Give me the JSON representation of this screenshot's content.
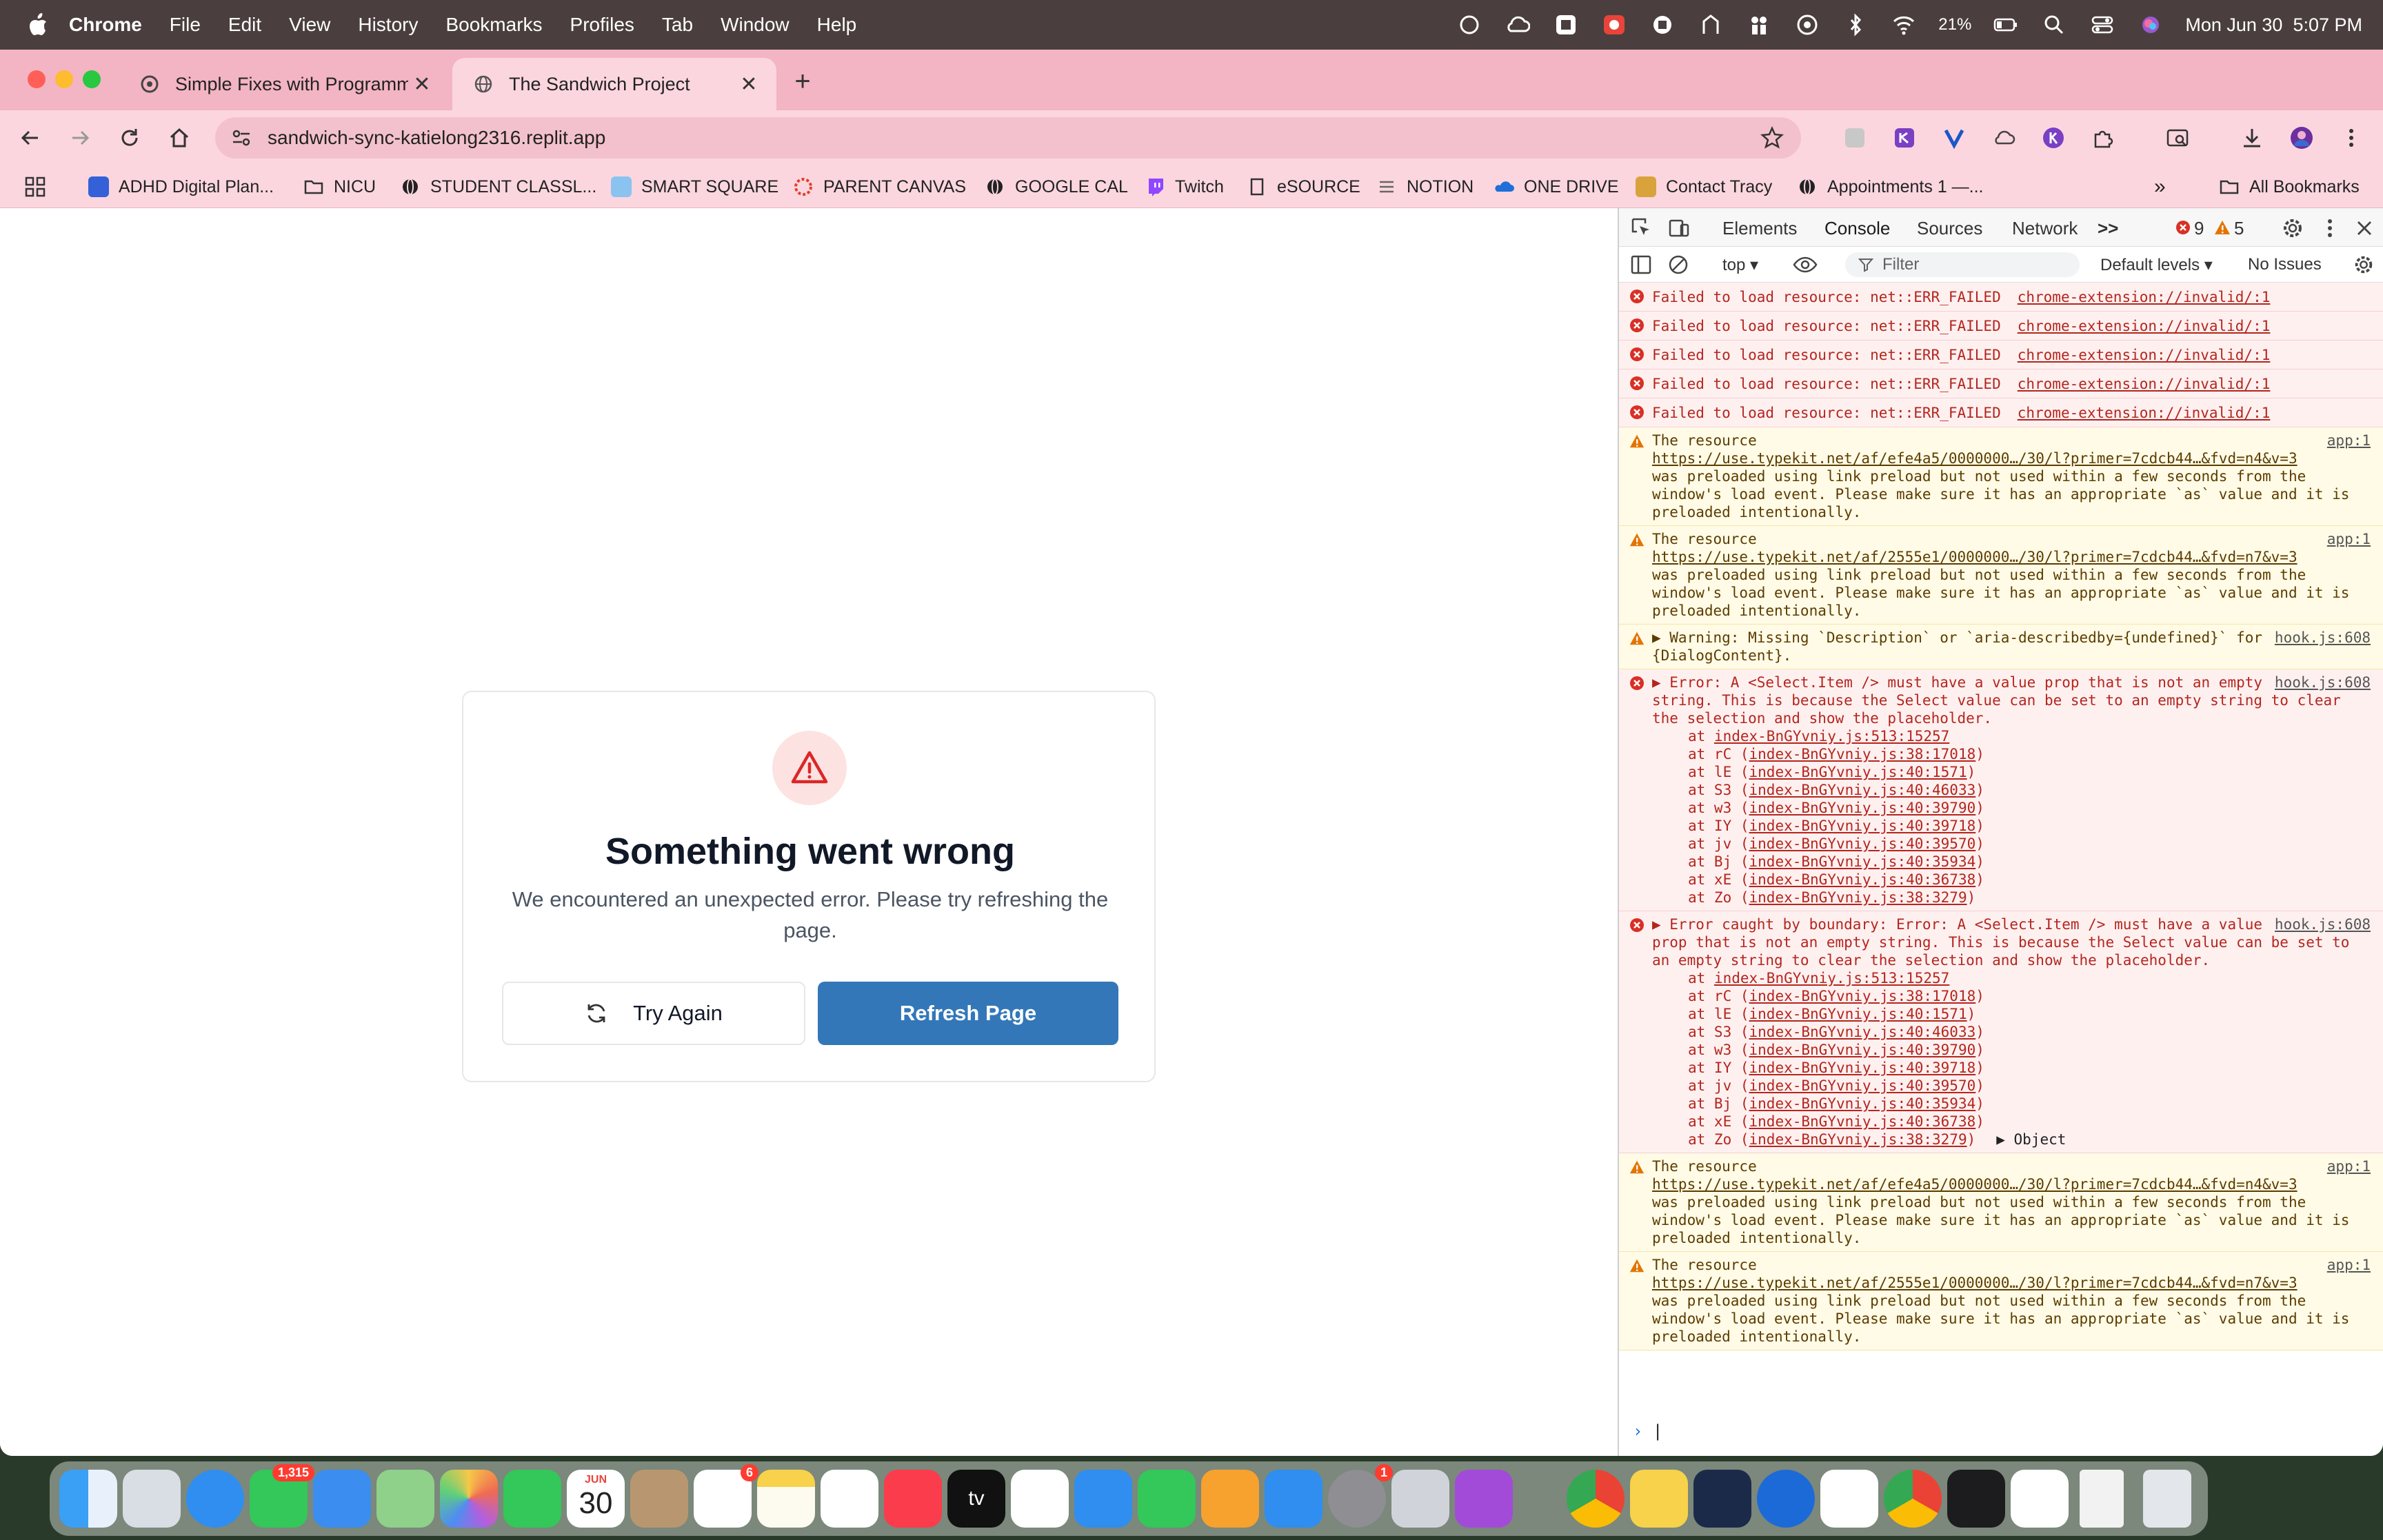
{
  "menubar": {
    "app": "Chrome",
    "items": [
      "File",
      "Edit",
      "View",
      "History",
      "Bookmarks",
      "Profiles",
      "Tab",
      "Window",
      "Help"
    ],
    "battery": "21%",
    "clock": "Mon Jun 30  5:07 PM"
  },
  "tabs": [
    {
      "title": "Simple Fixes with Programmin",
      "active": false
    },
    {
      "title": "The Sandwich Project",
      "active": true
    }
  ],
  "omnibox": {
    "url": "sandwich-sync-katielong2316.replit.app"
  },
  "bookmarks": {
    "items": [
      "ADHD Digital Plan...",
      "NICU",
      "STUDENT CLASSL...",
      "SMART SQUARE",
      "PARENT CANVAS",
      "GOOGLE CAL",
      "Twitch",
      "eSOURCE",
      "NOTION",
      "ONE DRIVE",
      "Contact Tracy",
      "Appointments 1 —..."
    ],
    "all": "All Bookmarks"
  },
  "error_card": {
    "title": "Something went wrong",
    "message": "We encountered an unexpected error. Please try refreshing the page.",
    "try_again": "Try Again",
    "refresh": "Refresh Page"
  },
  "devtools": {
    "tabs": [
      "Elements",
      "Console",
      "Sources",
      "Network"
    ],
    "more": ">>",
    "errors": "9",
    "warnings": "5",
    "context": "top",
    "filter_placeholder": "Filter",
    "levels": "Default levels",
    "issues": "No Issues",
    "failed_text": "Failed to load resource: net::ERR_FAILED",
    "failed_link": "chrome-extension://invalid/:1",
    "warn1": {
      "head": "The resource",
      "src": "app:1",
      "url": "https://use.typekit.net/af/efe4a5/0000000…/30/l?primer=7cdcb44…&fvd=n4&v=3",
      "body": "was preloaded using link preload but not used within a few seconds from the window's load event. Please make sure it has an appropriate `as` value and it is preloaded intentionally."
    },
    "warn2": {
      "head": "The resource",
      "src": "app:1",
      "url": "https://use.typekit.net/af/2555e1/0000000…/30/l?primer=7cdcb44…&fvd=n7&v=3",
      "body": "was preloaded using link preload but not used within a few seconds from the window's load event. Please make sure it has an appropriate `as` value and it is preloaded intentionally."
    },
    "warn3": {
      "text": "▶ Warning: Missing `Description` or `aria-describedby={undefined}` for {DialogContent}.",
      "src": "hook.js:608"
    },
    "err1": {
      "text": "▶ Error: A <Select.Item /> must have a value prop that is not an empty string. This is because the Select value can be set to an empty string to clear the selection and show the placeholder.",
      "src": "hook.js:608"
    },
    "err2": {
      "text": "▶ Error caught by boundary: Error: A <Select.Item /> must have a value prop that is not an empty string. This is because the Select value can be set to an empty string to clear the selection and show the placeholder.",
      "src": "hook.js:608",
      "object": "▶ Object"
    },
    "stack": [
      {
        "fn": "at ",
        "loc": "index-BnGYvniy.js:513:15257",
        "paren": false
      },
      {
        "fn": "at rC (",
        "loc": "index-BnGYvniy.js:38:17018",
        "paren": true
      },
      {
        "fn": "at lE (",
        "loc": "index-BnGYvniy.js:40:1571",
        "paren": true
      },
      {
        "fn": "at S3 (",
        "loc": "index-BnGYvniy.js:40:46033",
        "paren": true
      },
      {
        "fn": "at w3 (",
        "loc": "index-BnGYvniy.js:40:39790",
        "paren": true
      },
      {
        "fn": "at IY (",
        "loc": "index-BnGYvniy.js:40:39718",
        "paren": true
      },
      {
        "fn": "at jv (",
        "loc": "index-BnGYvniy.js:40:39570",
        "paren": true
      },
      {
        "fn": "at Bj (",
        "loc": "index-BnGYvniy.js:40:35934",
        "paren": true
      },
      {
        "fn": "at xE (",
        "loc": "index-BnGYvniy.js:40:36738",
        "paren": true
      },
      {
        "fn": "at Zo (",
        "loc": "index-BnGYvniy.js:38:3279",
        "paren": true
      }
    ],
    "prompt": "›"
  },
  "dock": {
    "messages_badge": "1,315",
    "calendar_month": "JUN",
    "calendar_day": "30",
    "reminders_badge": "6",
    "settings_badge": "1",
    "appletv_label": "tv"
  }
}
